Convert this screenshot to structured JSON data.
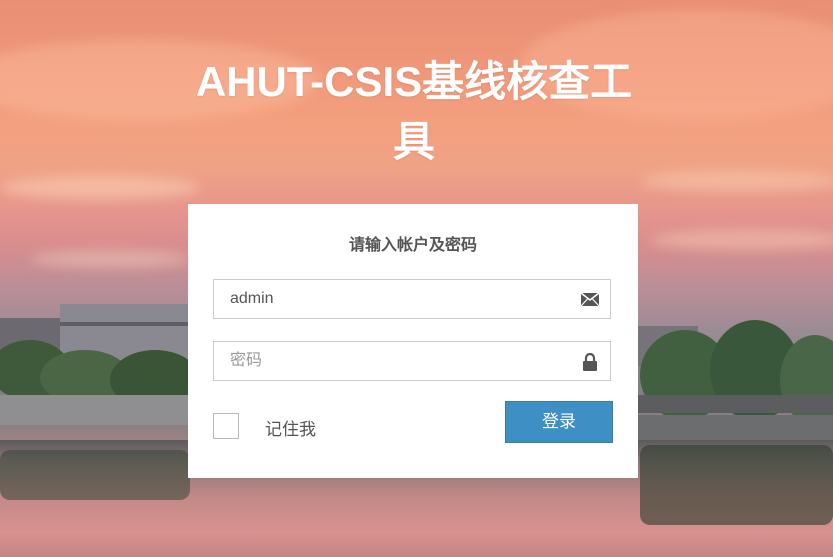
{
  "app": {
    "title": "AHUT-CSIS基线核查工具"
  },
  "login": {
    "heading": "请输入帐户及密码",
    "username": {
      "value": "admin",
      "icon": "envelope-icon"
    },
    "password": {
      "value": "",
      "placeholder": "密码",
      "icon": "lock-icon"
    },
    "remember_label": "记住我",
    "remember_checked": false,
    "submit_label": "登录"
  },
  "colors": {
    "button": "#3d8fc4",
    "panel": "#ffffff",
    "text": "#555555"
  }
}
